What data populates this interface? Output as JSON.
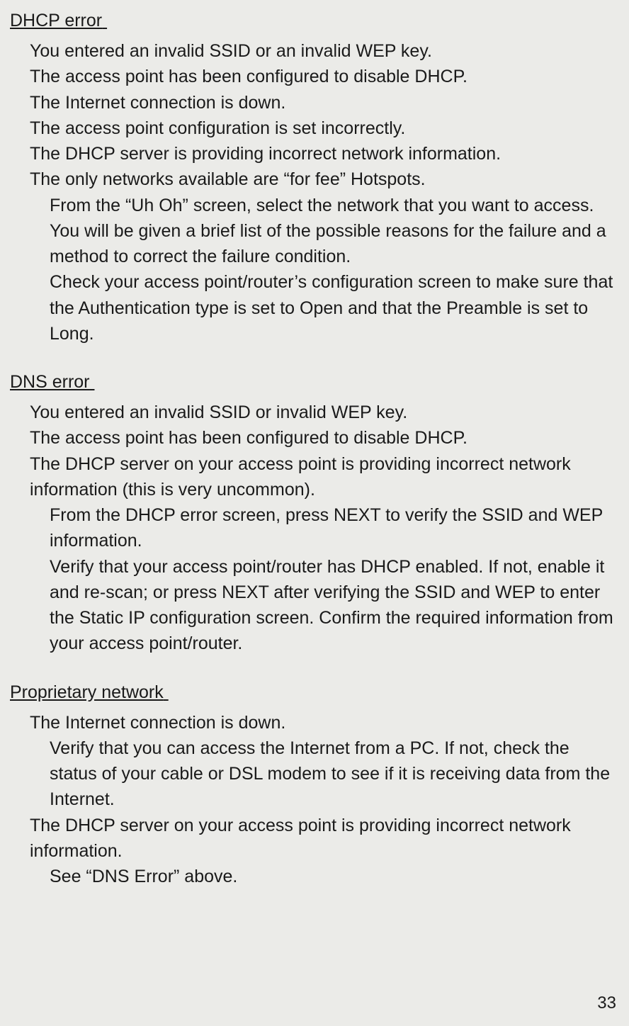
{
  "page_number": "33",
  "sections": [
    {
      "heading": "DHCP error",
      "lines": [
        {
          "indent": 1,
          "text": "You entered an invalid SSID or an invalid WEP key."
        },
        {
          "indent": 1,
          "text": "The access point has been configured to disable DHCP."
        },
        {
          "indent": 1,
          "text": "The Internet connection is down."
        },
        {
          "indent": 1,
          "text": "The access point configuration is set incorrectly."
        },
        {
          "indent": 1,
          "text": "The DHCP server is providing incorrect network information."
        },
        {
          "indent": 1,
          "text": "The only networks available are “for fee” Hotspots."
        },
        {
          "indent": 2,
          "text": "From the “Uh Oh” screen, select the network that you want to access.  You will be given a brief list of the possible reasons for the failure and a method to correct the failure condition."
        },
        {
          "indent": 2,
          "text": "Check your access point/router’s configuration screen to make sure that the Authentication type is set to Open and that the Preamble is set to Long."
        }
      ]
    },
    {
      "heading": "DNS error",
      "lines": [
        {
          "indent": 1,
          "text": "You entered an invalid SSID or invalid WEP key."
        },
        {
          "indent": 1,
          "text": "The access point has been configured to disable DHCP."
        },
        {
          "indent": 1,
          "text": "The DHCP server on your access point is providing incorrect network information (this is very uncommon)."
        },
        {
          "indent": 2,
          "text": "From the DHCP error screen, press NEXT to verify the SSID and WEP information."
        },
        {
          "indent": 2,
          "text": "Verify that your access point/router has DHCP enabled.    If not, enable it and re-scan; or press NEXT after verifying the SSID and WEP to enter the Static IP configuration screen.    Confirm the required information from your access point/router."
        }
      ]
    },
    {
      "heading": "Proprietary network",
      "lines": [
        {
          "indent": 1,
          "text": "The Internet connection is down."
        },
        {
          "indent": 2,
          "text": "Verify that you can access the Internet from a PC.    If not, check the status of your cable or DSL modem to see if it is receiving data from the Internet."
        },
        {
          "indent": 1,
          "text": "The DHCP server on your access point is providing incorrect network information."
        },
        {
          "indent": 2,
          "text": "See “DNS Error” above."
        }
      ]
    }
  ]
}
